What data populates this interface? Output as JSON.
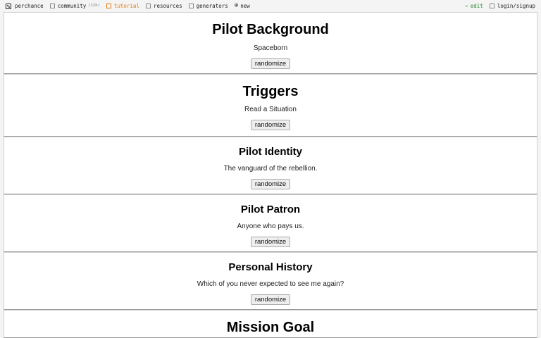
{
  "topbar": {
    "brand": "perchance",
    "community": "community",
    "community_badge": "(12h)",
    "tutorial": "tutorial",
    "resources": "resources",
    "generators": "generators",
    "new": "new",
    "edit": "edit",
    "login": "login/signup",
    "colors": {
      "tutorial": "#e07a14",
      "edit": "#2e8b2e"
    }
  },
  "panels": [
    {
      "title": "Pilot Background",
      "result": "Spaceborn",
      "button": "randomize"
    },
    {
      "title": "Triggers",
      "result": "Read a Situation",
      "button": "randomize"
    },
    {
      "title": "Pilot Identity",
      "result": "The vanguard of the rebellion.",
      "button": "randomize"
    },
    {
      "title": "Pilot Patron",
      "result": "Anyone who pays us.",
      "button": "randomize"
    },
    {
      "title": "Personal History",
      "result": "Which of you never expected to see me again?",
      "button": "randomize"
    },
    {
      "title": "Mission Goal"
    }
  ]
}
